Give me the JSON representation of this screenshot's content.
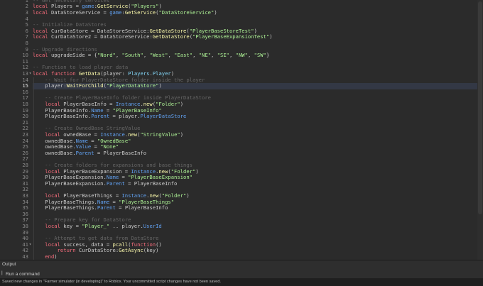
{
  "editor": {
    "lines": [
      {
        "n": "1",
        "indent": 0,
        "tokens": [
          [
            "com",
            "-- Get necessary services"
          ]
        ]
      },
      {
        "n": "2",
        "indent": 0,
        "tokens": [
          [
            "kw",
            "local"
          ],
          [
            "txt",
            " Players = "
          ],
          [
            "prop",
            "game"
          ],
          [
            "txt",
            ":"
          ],
          [
            "fn",
            "GetService"
          ],
          [
            "txt",
            "("
          ],
          [
            "str",
            "\"Players\""
          ],
          [
            "txt",
            ")"
          ]
        ]
      },
      {
        "n": "3",
        "indent": 0,
        "tokens": [
          [
            "kw",
            "local"
          ],
          [
            "txt",
            " DataStoreService = "
          ],
          [
            "prop",
            "game"
          ],
          [
            "txt",
            ":"
          ],
          [
            "fn",
            "GetService"
          ],
          [
            "txt",
            "("
          ],
          [
            "str",
            "\"DataStoreService\""
          ],
          [
            "txt",
            ")"
          ]
        ]
      },
      {
        "n": "4",
        "indent": 0,
        "tokens": []
      },
      {
        "n": "5",
        "indent": 0,
        "tokens": [
          [
            "com",
            "-- Initialize DataStores"
          ]
        ]
      },
      {
        "n": "6",
        "indent": 0,
        "tokens": [
          [
            "kw",
            "local"
          ],
          [
            "txt",
            " CurDataStore = DataStoreService:"
          ],
          [
            "fn",
            "GetDataStore"
          ],
          [
            "txt",
            "("
          ],
          [
            "str",
            "\"PlayerBaseStoreTest\""
          ],
          [
            "txt",
            ")"
          ]
        ]
      },
      {
        "n": "7",
        "indent": 0,
        "tokens": [
          [
            "kw",
            "local"
          ],
          [
            "txt",
            " CurDataStore2 = DataStoreService:"
          ],
          [
            "fn",
            "GetDataStore"
          ],
          [
            "txt",
            "("
          ],
          [
            "str",
            "\"PlayerBaseExpansionTest\""
          ],
          [
            "txt",
            ")"
          ]
        ]
      },
      {
        "n": "8",
        "indent": 0,
        "tokens": []
      },
      {
        "n": "9",
        "indent": 0,
        "tokens": [
          [
            "com",
            "-- Upgrade directions"
          ]
        ]
      },
      {
        "n": "10",
        "indent": 0,
        "tokens": [
          [
            "kw",
            "local"
          ],
          [
            "txt",
            " upgradeSide = {"
          ],
          [
            "str",
            "\"Nord\""
          ],
          [
            "txt",
            ", "
          ],
          [
            "str",
            "\"South\""
          ],
          [
            "txt",
            ", "
          ],
          [
            "str",
            "\"West\""
          ],
          [
            "txt",
            ", "
          ],
          [
            "str",
            "\"East\""
          ],
          [
            "txt",
            ", "
          ],
          [
            "str",
            "\"NE\""
          ],
          [
            "txt",
            ", "
          ],
          [
            "str",
            "\"SE\""
          ],
          [
            "txt",
            ", "
          ],
          [
            "str",
            "\"NW\""
          ],
          [
            "txt",
            ", "
          ],
          [
            "str",
            "\"SW\""
          ],
          [
            "txt",
            "}"
          ]
        ]
      },
      {
        "n": "11",
        "indent": 0,
        "tokens": []
      },
      {
        "n": "12",
        "indent": 0,
        "tokens": [
          [
            "com",
            "-- Function to load player data"
          ]
        ]
      },
      {
        "n": "13",
        "indent": 0,
        "fold": true,
        "tokens": [
          [
            "kw",
            "local function"
          ],
          [
            "txt",
            " "
          ],
          [
            "fn",
            "GetData"
          ],
          [
            "txt",
            "(player: "
          ],
          [
            "typ",
            "Players"
          ],
          [
            "txt",
            "."
          ],
          [
            "typ",
            "Player"
          ],
          [
            "txt",
            ")"
          ]
        ]
      },
      {
        "n": "14",
        "indent": 1,
        "tokens": [
          [
            "com",
            "-- Wait for PlayerDataStore folder inside the player"
          ]
        ]
      },
      {
        "n": "15",
        "indent": 1,
        "current": true,
        "tokens": [
          [
            "txt",
            "player:"
          ],
          [
            "fn",
            "WaitForChild"
          ],
          [
            "txt",
            "("
          ],
          [
            "str",
            "\"PlayerDataStore\""
          ],
          [
            "txt",
            ")"
          ]
        ]
      },
      {
        "n": "16",
        "indent": 1,
        "tokens": []
      },
      {
        "n": "17",
        "indent": 1,
        "tokens": [
          [
            "com",
            "-- Create PlayerBaseInfo folder inside PlayerDataStore"
          ]
        ]
      },
      {
        "n": "18",
        "indent": 1,
        "tokens": [
          [
            "kw",
            "local"
          ],
          [
            "txt",
            " PlayerBaseInfo = "
          ],
          [
            "prop",
            "Instance"
          ],
          [
            "txt",
            "."
          ],
          [
            "fn",
            "new"
          ],
          [
            "txt",
            "("
          ],
          [
            "str",
            "\"Folder\""
          ],
          [
            "txt",
            ")"
          ]
        ]
      },
      {
        "n": "19",
        "indent": 1,
        "tokens": [
          [
            "txt",
            "PlayerBaseInfo."
          ],
          [
            "prop",
            "Name"
          ],
          [
            "txt",
            " = "
          ],
          [
            "str",
            "\"PlayerBaseInfo\""
          ]
        ]
      },
      {
        "n": "20",
        "indent": 1,
        "tokens": [
          [
            "txt",
            "PlayerBaseInfo."
          ],
          [
            "prop",
            "Parent"
          ],
          [
            "txt",
            " = player."
          ],
          [
            "prop",
            "PlayerDataStore"
          ]
        ]
      },
      {
        "n": "21",
        "indent": 1,
        "tokens": []
      },
      {
        "n": "22",
        "indent": 1,
        "tokens": [
          [
            "com",
            "-- Create OwnedBase StringValue"
          ]
        ]
      },
      {
        "n": "23",
        "indent": 1,
        "tokens": [
          [
            "kw",
            "local"
          ],
          [
            "txt",
            " ownedBase = "
          ],
          [
            "prop",
            "Instance"
          ],
          [
            "txt",
            "."
          ],
          [
            "fn",
            "new"
          ],
          [
            "txt",
            "("
          ],
          [
            "str",
            "\"StringValue\""
          ],
          [
            "txt",
            ")"
          ]
        ]
      },
      {
        "n": "24",
        "indent": 1,
        "tokens": [
          [
            "txt",
            "ownedBase."
          ],
          [
            "prop",
            "Name"
          ],
          [
            "txt",
            " = "
          ],
          [
            "str",
            "\"OwnedBase\""
          ]
        ]
      },
      {
        "n": "25",
        "indent": 1,
        "tokens": [
          [
            "txt",
            "ownedBase."
          ],
          [
            "prop",
            "Value"
          ],
          [
            "txt",
            " = "
          ],
          [
            "str",
            "\"None\""
          ]
        ]
      },
      {
        "n": "26",
        "indent": 1,
        "tokens": [
          [
            "txt",
            "ownedBase."
          ],
          [
            "prop",
            "Parent"
          ],
          [
            "txt",
            " = PlayerBaseInfo"
          ]
        ]
      },
      {
        "n": "27",
        "indent": 1,
        "tokens": []
      },
      {
        "n": "28",
        "indent": 1,
        "tokens": [
          [
            "com",
            "-- Create folders for expansions and base things"
          ]
        ]
      },
      {
        "n": "29",
        "indent": 1,
        "tokens": [
          [
            "kw",
            "local"
          ],
          [
            "txt",
            " PlayerBaseExpansion = "
          ],
          [
            "prop",
            "Instance"
          ],
          [
            "txt",
            "."
          ],
          [
            "fn",
            "new"
          ],
          [
            "txt",
            "("
          ],
          [
            "str",
            "\"Folder\""
          ],
          [
            "txt",
            ")"
          ]
        ]
      },
      {
        "n": "30",
        "indent": 1,
        "tokens": [
          [
            "txt",
            "PlayerBaseExpansion."
          ],
          [
            "prop",
            "Name"
          ],
          [
            "txt",
            " = "
          ],
          [
            "str",
            "\"PlayerBaseExpansion\""
          ]
        ]
      },
      {
        "n": "31",
        "indent": 1,
        "tokens": [
          [
            "txt",
            "PlayerBaseExpansion."
          ],
          [
            "prop",
            "Parent"
          ],
          [
            "txt",
            " = PlayerBaseInfo"
          ]
        ]
      },
      {
        "n": "32",
        "indent": 1,
        "tokens": []
      },
      {
        "n": "33",
        "indent": 1,
        "tokens": [
          [
            "kw",
            "local"
          ],
          [
            "txt",
            " PlayerBaseThings = "
          ],
          [
            "prop",
            "Instance"
          ],
          [
            "txt",
            "."
          ],
          [
            "fn",
            "new"
          ],
          [
            "txt",
            "("
          ],
          [
            "str",
            "\"Folder\""
          ],
          [
            "txt",
            ")"
          ]
        ]
      },
      {
        "n": "34",
        "indent": 1,
        "tokens": [
          [
            "txt",
            "PlayerBaseThings."
          ],
          [
            "prop",
            "Name"
          ],
          [
            "txt",
            " = "
          ],
          [
            "str",
            "\"PlayerBaseThings\""
          ]
        ]
      },
      {
        "n": "35",
        "indent": 1,
        "tokens": [
          [
            "txt",
            "PlayerBaseThings."
          ],
          [
            "prop",
            "Parent"
          ],
          [
            "txt",
            " = PlayerBaseInfo"
          ]
        ]
      },
      {
        "n": "36",
        "indent": 1,
        "tokens": []
      },
      {
        "n": "37",
        "indent": 1,
        "tokens": [
          [
            "com",
            "-- Prepare key for DataStore"
          ]
        ]
      },
      {
        "n": "38",
        "indent": 1,
        "tokens": [
          [
            "kw",
            "local"
          ],
          [
            "txt",
            " key = "
          ],
          [
            "str",
            "\"Player_\""
          ],
          [
            "txt",
            " .. player."
          ],
          [
            "prop",
            "UserId"
          ]
        ]
      },
      {
        "n": "39",
        "indent": 1,
        "tokens": []
      },
      {
        "n": "40",
        "indent": 1,
        "tokens": [
          [
            "com",
            "-- Attempt to get data from DataStore"
          ]
        ]
      },
      {
        "n": "41",
        "indent": 1,
        "fold": true,
        "tokens": [
          [
            "kw",
            "local"
          ],
          [
            "txt",
            " success, data = "
          ],
          [
            "fn",
            "pcall"
          ],
          [
            "txt",
            "("
          ],
          [
            "kw",
            "function"
          ],
          [
            "txt",
            "()"
          ]
        ]
      },
      {
        "n": "42",
        "indent": 2,
        "tokens": [
          [
            "kw",
            "return"
          ],
          [
            "txt",
            " CurDataStore:"
          ],
          [
            "fn",
            "GetAsync"
          ],
          [
            "txt",
            "(key)"
          ]
        ]
      },
      {
        "n": "43",
        "indent": 1,
        "tokens": [
          [
            "kw",
            "end"
          ],
          [
            "txt",
            ")"
          ]
        ]
      }
    ]
  },
  "output": {
    "title": "Output",
    "caret": "|",
    "command_placeholder": "Run a command"
  },
  "status": {
    "message": "Saved new changes in \"Farmer simulator (in developing)\" to Roblox. Your uncommitted script changes have not been saved."
  },
  "colors": {
    "keyword": "#f86d7c",
    "string": "#adf195",
    "comment": "#666666",
    "function": "#fdfbac",
    "property": "#61a1f1",
    "type": "#84d6f7",
    "text": "#cccccc",
    "background": "#2b2b2b"
  }
}
